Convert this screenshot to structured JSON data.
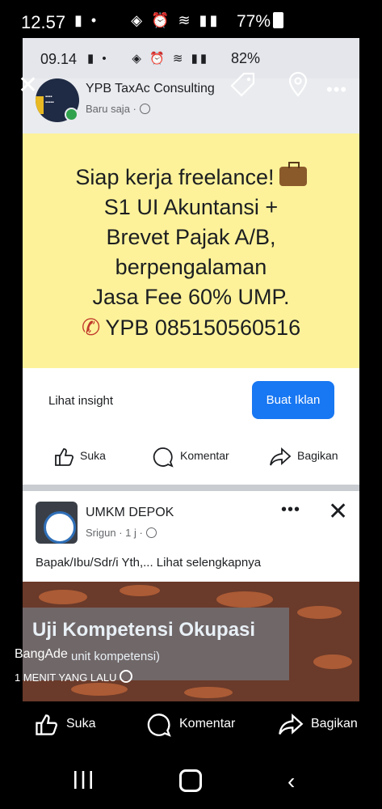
{
  "outer_status": {
    "time": "12.57",
    "battery": "77%"
  },
  "inner_status": {
    "time": "09.14",
    "battery": "82%"
  },
  "post1": {
    "page_name": "YPB TaxAc Consulting",
    "time": "Baru saja",
    "ad_lines": [
      "Siap kerja freelance!",
      "S1 UI Akuntansi +",
      "Brevet Pajak A/B,",
      "berpengalaman",
      "Jasa Fee 60% UMP.",
      "YPB 085150560516"
    ],
    "insight_label": "Lihat insight",
    "ad_button": "Buat Iklan",
    "actions": {
      "like": "Suka",
      "comment": "Komentar",
      "share": "Bagikan"
    }
  },
  "post2": {
    "page_name": "UMKM DEPOK",
    "meta": "Srigun · 1 j ·",
    "body": "Bapak/Ibu/Sdr/i Yth,... Lihat selengkapnya",
    "video_title": "Uji Kompetensi Okupasi",
    "video_sub": "unit kompetensi)"
  },
  "viewer": {
    "uploader": "BangAde",
    "uploaded": "1 MENIT YANG LALU",
    "actions": {
      "like": "Suka",
      "comment": "Komentar",
      "share": "Bagikan"
    }
  },
  "colors": {
    "accent": "#1877f2",
    "banner": "#fdf29a",
    "online": "#31a24c"
  }
}
